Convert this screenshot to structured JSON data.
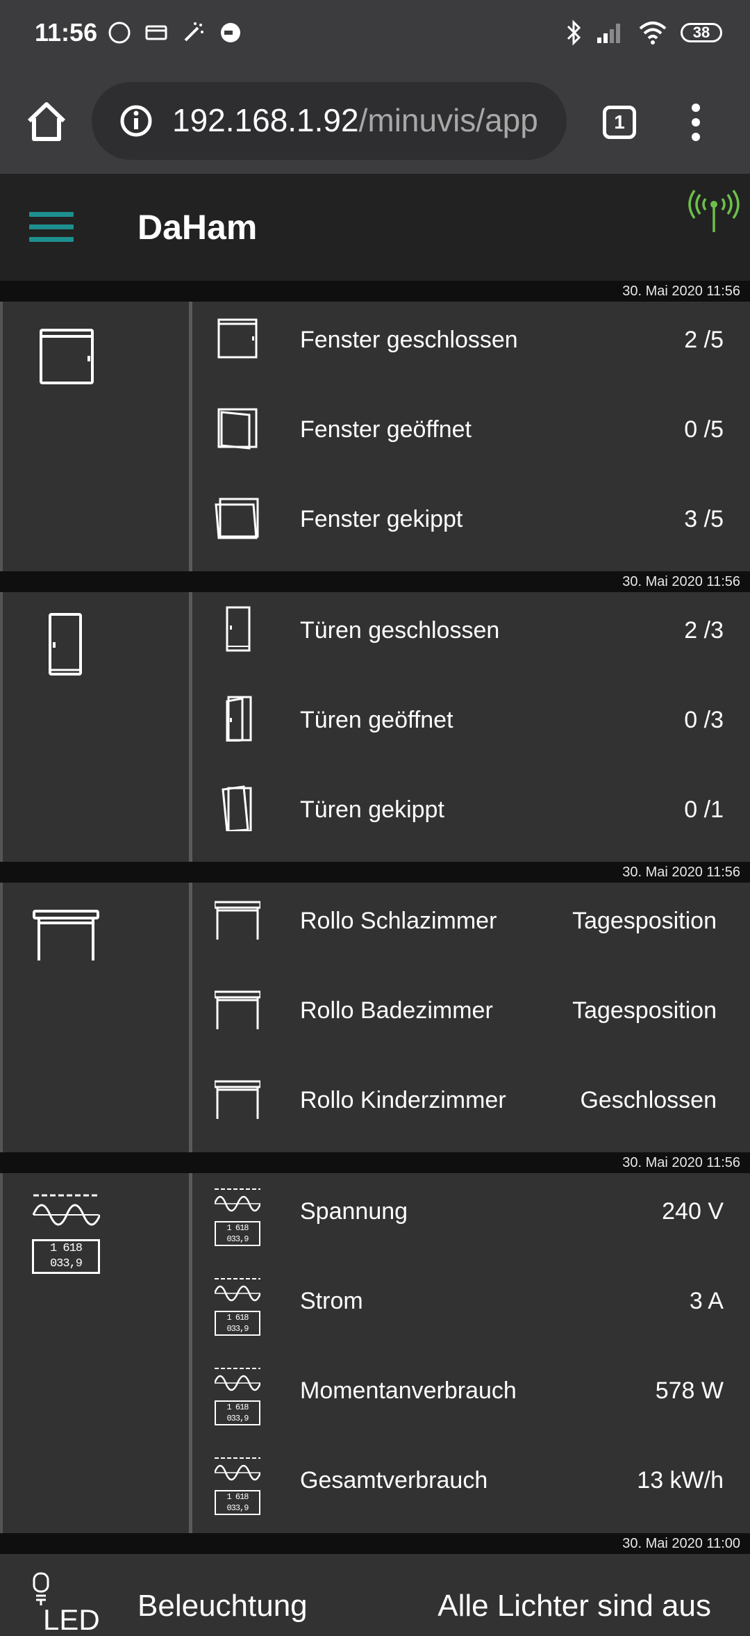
{
  "status_bar": {
    "time": "11:56",
    "battery": "38"
  },
  "browser": {
    "url_host": "192.168.1.92",
    "url_path": "/minuvis/app",
    "tab_count": "1"
  },
  "app": {
    "title": "DaHam"
  },
  "sections": [
    {
      "timestamp": "30. Mai 2020 11:56",
      "rows": [
        {
          "label": "Fenster geschlossen",
          "value": "2 /5"
        },
        {
          "label": "Fenster geöffnet",
          "value": "0 /5"
        },
        {
          "label": "Fenster gekippt",
          "value": "3 /5"
        }
      ]
    },
    {
      "timestamp": "30. Mai 2020 11:56",
      "rows": [
        {
          "label": "Türen geschlossen",
          "value": "2 /3"
        },
        {
          "label": "Türen geöffnet",
          "value": "0 /3"
        },
        {
          "label": "Türen gekippt",
          "value": "0 /1"
        }
      ]
    },
    {
      "timestamp": "30. Mai 2020 11:56",
      "rows": [
        {
          "label": "Rollo Schlazimmer",
          "value": "Tagesposition"
        },
        {
          "label": "Rollo Badezimmer",
          "value": "Tagesposition"
        },
        {
          "label": "Rollo Kinderzimmer",
          "value": "Geschlossen"
        }
      ]
    },
    {
      "timestamp": "30. Mai 2020 11:56",
      "meter_digits": "1 618 033,9",
      "rows": [
        {
          "label": "Spannung",
          "value": "240 V"
        },
        {
          "label": "Strom",
          "value": "3 A"
        },
        {
          "label": "Momentanverbrauch",
          "value": "578 W"
        },
        {
          "label": "Gesamtverbrauch",
          "value": "13 kW/h"
        }
      ]
    },
    {
      "timestamp": "30. Mai 2020 11:00",
      "label": "Beleuchtung",
      "value": "Alle Lichter sind aus",
      "icon_text": "LED"
    }
  ],
  "colors": {
    "accent": "#1e8f8f",
    "signal": "#6cc04a",
    "background": "#323232"
  }
}
